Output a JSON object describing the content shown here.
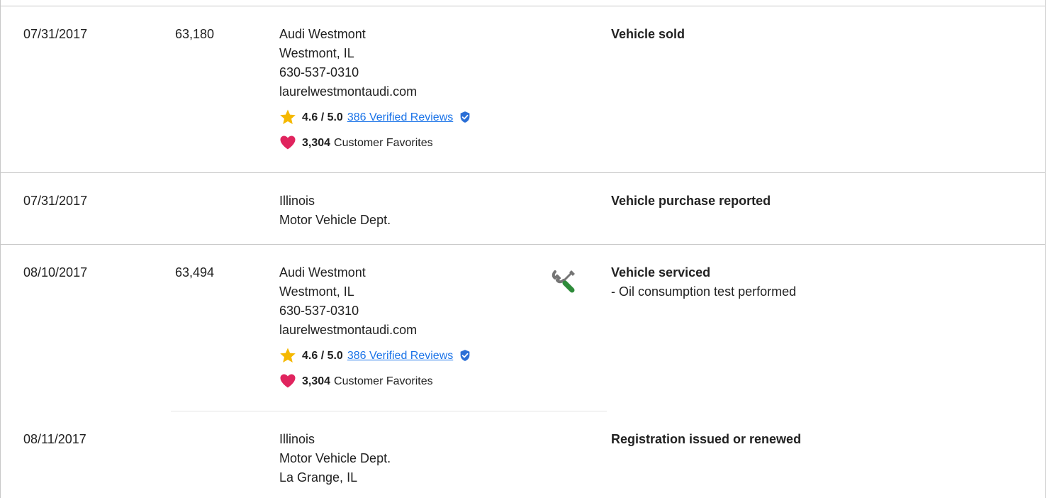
{
  "records": [
    {
      "date": "07/31/2017",
      "mileage": "63,180",
      "source": [
        "Audi Westmont",
        "Westmont, IL",
        "630-537-0310",
        "laurelwestmontaudi.com"
      ],
      "rating": "4.6 / 5.0",
      "reviews": "386 Verified Reviews",
      "favorites_count": "3,304",
      "favorites_label": "Customer Favorites",
      "comments_title": "Vehicle sold",
      "comments_detail": ""
    },
    {
      "date": "07/31/2017",
      "mileage": "",
      "source": [
        "Illinois",
        "Motor Vehicle Dept."
      ],
      "comments_title": "Vehicle purchase reported",
      "comments_detail": ""
    },
    {
      "date": "08/10/2017",
      "mileage": "63,494",
      "source": [
        "Audi Westmont",
        "Westmont, IL",
        "630-537-0310",
        "laurelwestmontaudi.com"
      ],
      "rating": "4.6 / 5.0",
      "reviews": "386 Verified Reviews",
      "favorites_count": "3,304",
      "favorites_label": "Customer Favorites",
      "service_icon": "wrench-screwdriver-icon",
      "comments_title": "Vehicle serviced",
      "comments_detail": "- Oil consumption test performed"
    },
    {
      "date": "08/11/2017",
      "mileage": "",
      "source": [
        "Illinois",
        "Motor Vehicle Dept.",
        "La Grange, IL"
      ],
      "comments_title": "Registration issued or renewed",
      "comments_detail": ""
    }
  ],
  "colors": {
    "star": "#f5b800",
    "heart": "#e0245e",
    "link": "#1a73e8",
    "verified": "#2b6fd6",
    "divider": "#c8c8c8",
    "tool_gray": "#757575",
    "tool_green": "#2e8b3a"
  }
}
